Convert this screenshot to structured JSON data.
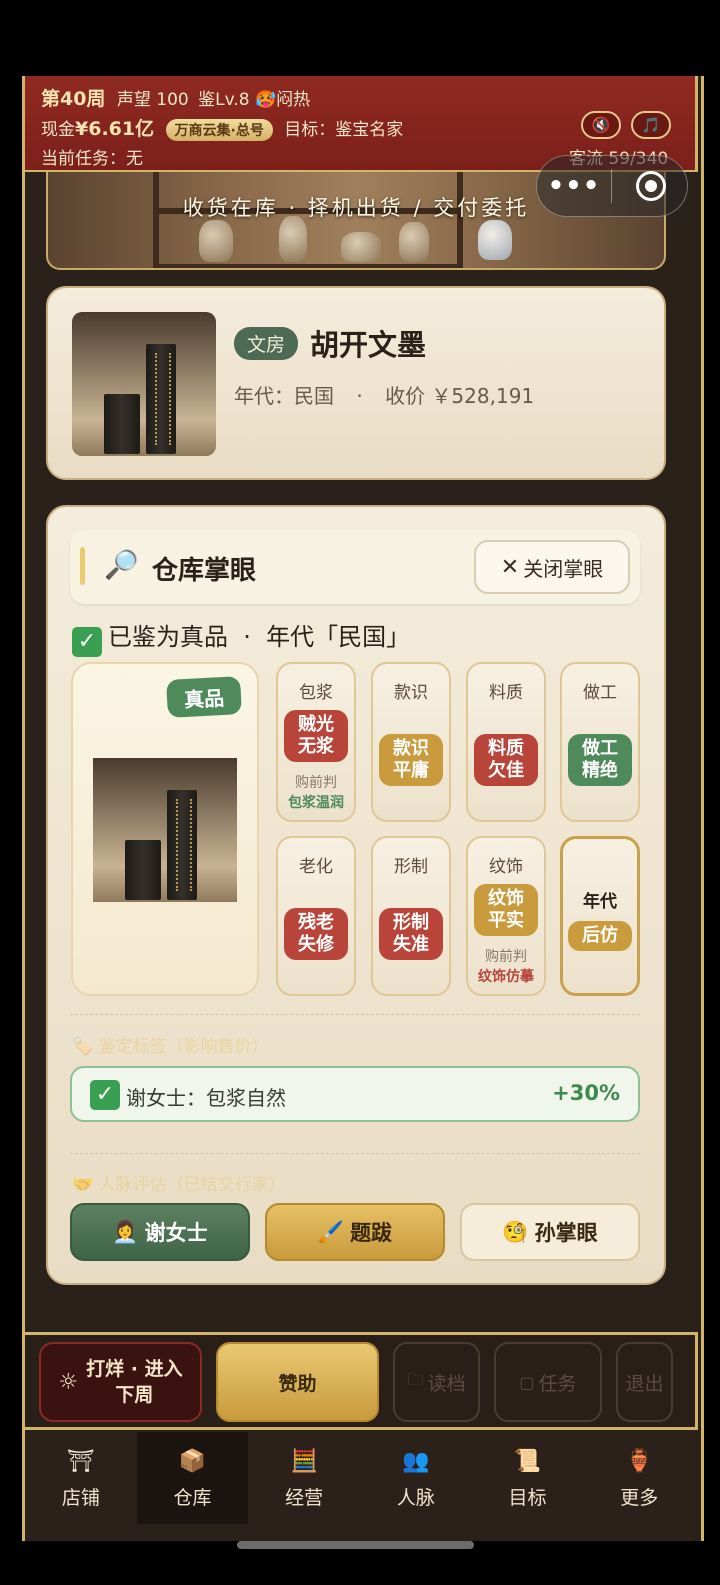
{
  "status": {
    "week": "第40周",
    "reputation": "声望 100",
    "appraise_level": "鉴Lv.8",
    "weather": "🥵闷热",
    "cash_label": "现金",
    "cash_value": "¥6.61亿",
    "merchant_tag": "万商云集·总号",
    "goal": "目标：鉴宝名家",
    "task": "当前任务：无",
    "traffic": "客流 59/340",
    "mute_icon": "🔇",
    "music_icon": "🎵"
  },
  "capsule": {
    "more": "•••"
  },
  "banner": {
    "text": "收货在库 · 择机出货 / 交付委托"
  },
  "item": {
    "category": "文房",
    "name": "胡开文墨",
    "era_label": "年代：民国",
    "sep": "·",
    "price_label": "收价 ￥528,191"
  },
  "panel": {
    "title": "仓库掌眼",
    "close_label": "关闭掌眼",
    "verdict": "已鉴为真品  ·  年代「民国」",
    "authentic_badge": "真品",
    "tiles": [
      {
        "label": "包浆",
        "pill": "贼光\n无浆",
        "note": "购前判",
        "note2": "包浆温润"
      },
      {
        "label": "款识",
        "pill": "款识\n平庸"
      },
      {
        "label": "料质",
        "pill": "料质\n欠佳"
      },
      {
        "label": "做工",
        "pill": "做工\n精绝"
      },
      {
        "label": "老化",
        "pill": "残老\n失修"
      },
      {
        "label": "形制",
        "pill": "形制\n失准"
      },
      {
        "label": "纹饰",
        "pill": "纹饰\n平实",
        "note": "购前判",
        "note2": "纹饰仿摹"
      },
      {
        "label": "年代",
        "pill": "后仿"
      }
    ],
    "tags_faded": "🏷️ 鉴定标签（影响售价）",
    "buff_text": "谢女士：包浆自然",
    "buff_value": "+30%",
    "network_faded": "🤝 人脉评估（已结交行家）",
    "actions": [
      {
        "label": "谢女士",
        "icon": "👩‍💼"
      },
      {
        "label": "题跋",
        "icon": "🖌️"
      },
      {
        "label": "孙掌眼",
        "icon": "🧐"
      }
    ]
  },
  "bottom": {
    "next_week": "打烊 · 进入\n下周",
    "sponsor": "赞助",
    "load": "读档",
    "tasks": "任务",
    "exit": "退出"
  },
  "tabs": [
    "店铺",
    "仓库",
    "经营",
    "人脉",
    "目标",
    "更多"
  ],
  "colors": {
    "header_red": "#8f2a22",
    "gold": "#d2b46a",
    "green": "#4e8a5a",
    "red_pill": "#b8443a"
  }
}
